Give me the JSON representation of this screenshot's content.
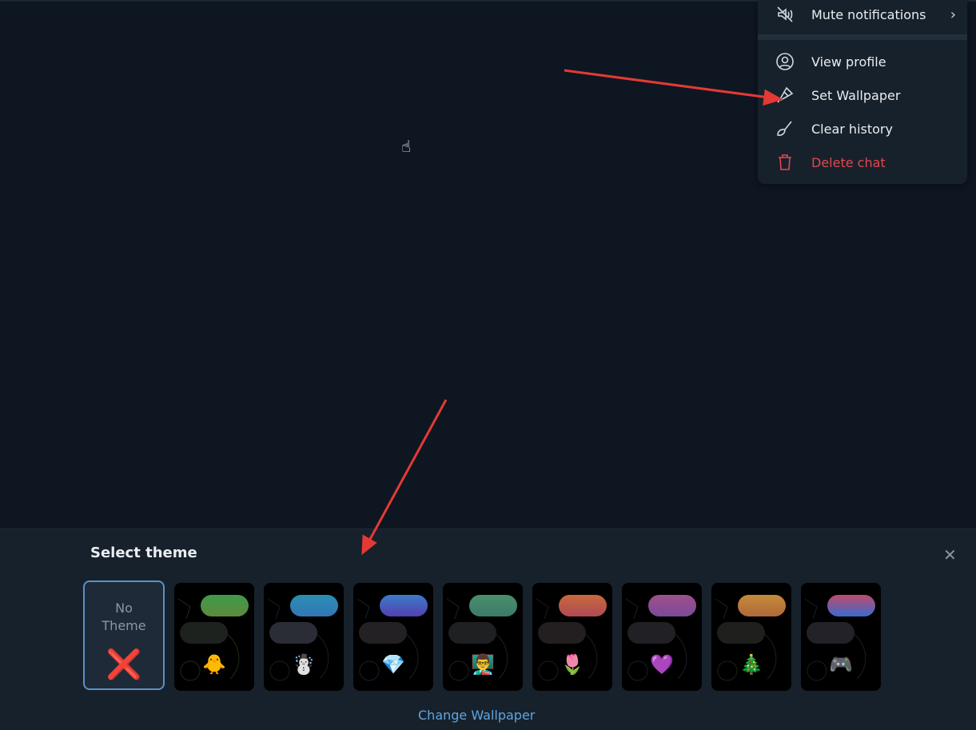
{
  "menu": {
    "items": [
      {
        "label": "Mute notifications",
        "icon": "mute-icon",
        "submenu": true
      },
      {
        "label": "View profile",
        "icon": "profile-icon"
      },
      {
        "label": "Set Wallpaper",
        "icon": "brush-icon"
      },
      {
        "label": "Clear history",
        "icon": "broom-icon"
      },
      {
        "label": "Delete chat",
        "icon": "trash-icon",
        "color": "#e5464e"
      }
    ]
  },
  "theme_panel": {
    "title": "Select theme",
    "no_theme_label": "No Theme",
    "no_theme_icon": "❌",
    "themes": [
      {
        "emoji": "🐥",
        "bubble": [
          "#3f9a4a",
          "#5d8a3c"
        ],
        "bubble2": "#1e221f",
        "deco": "#6b7a3a"
      },
      {
        "emoji": "☃️",
        "bubble": [
          "#2a8fb0",
          "#3276b8"
        ],
        "bubble2": "#2a2d35",
        "deco": "#3c5a6e"
      },
      {
        "emoji": "💎",
        "bubble": [
          "#3a7cc8",
          "#5440b0"
        ],
        "bubble2": "#232124",
        "deco": "#4a5a8a"
      },
      {
        "emoji": "👨‍🏫",
        "bubble": [
          "#4c8f6a",
          "#3b7a6a"
        ],
        "bubble2": "#1f2022",
        "deco": "#3a6a6a"
      },
      {
        "emoji": "🌷",
        "bubble": [
          "#c76a3a",
          "#b04a55"
        ],
        "bubble2": "#231f20",
        "deco": "#6a4a3a"
      },
      {
        "emoji": "💜",
        "bubble": [
          "#a0508a",
          "#7a4a9a"
        ],
        "bubble2": "#212025",
        "deco": "#5a4a7a"
      },
      {
        "emoji": "🎄",
        "bubble": [
          "#c48a3a",
          "#b06a3a"
        ],
        "bubble2": "#1f201e",
        "deco": "#6a5a3a"
      },
      {
        "emoji": "🎮",
        "bubble": [
          "#c04a6a",
          "#3a6ad0"
        ],
        "bubble2": "#232229",
        "deco": "#3a5a7a"
      }
    ],
    "change_wallpaper": "Change Wallpaper",
    "close_icon": "close-icon"
  },
  "annotation_color": "#e53935"
}
